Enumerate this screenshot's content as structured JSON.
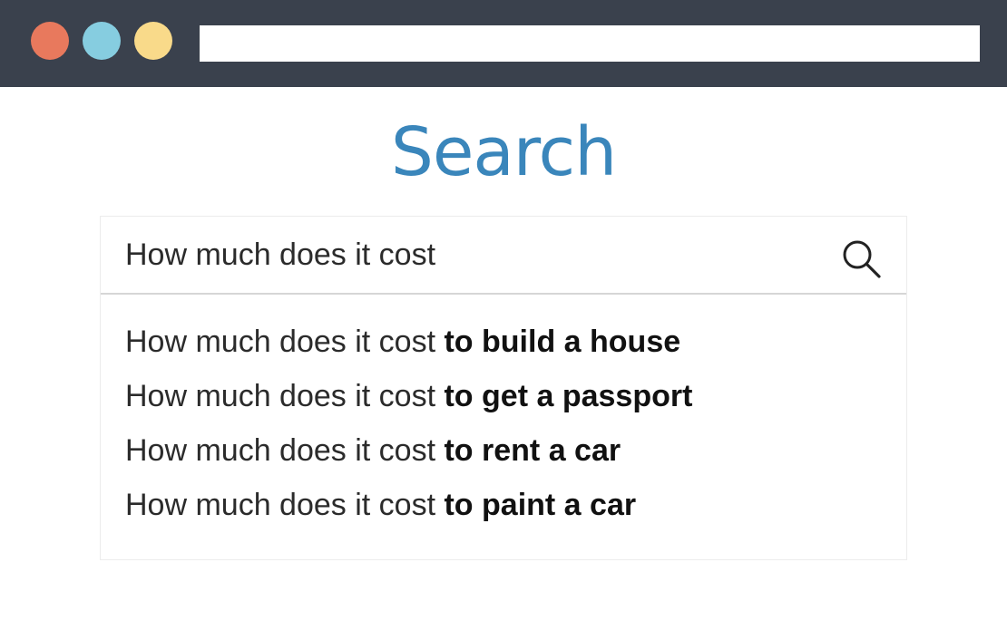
{
  "colors": {
    "titlebar_bg": "#3a414d",
    "dot_red": "#e8795d",
    "dot_blue": "#86cde0",
    "dot_yellow": "#f9da8a",
    "title_color": "#3a86bb"
  },
  "window": {
    "address_bar_value": ""
  },
  "page": {
    "title": "Search"
  },
  "search": {
    "query": "How much does it cost",
    "icon": "search-icon"
  },
  "suggestions": [
    {
      "prefix": "How much does it cost",
      "completion": "to build a house"
    },
    {
      "prefix": "How much does it cost",
      "completion": "to get a passport"
    },
    {
      "prefix": "How much does it cost",
      "completion": "to rent a car"
    },
    {
      "prefix": "How much does it cost",
      "completion": "to paint a car"
    }
  ]
}
